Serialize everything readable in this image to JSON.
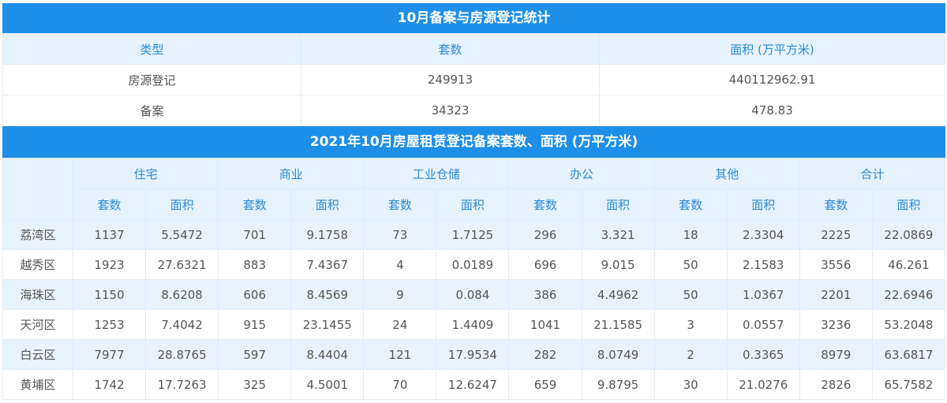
{
  "table1": {
    "title": "10月备案与房源登记统计",
    "headers": [
      "类型",
      "套数",
      "面积 (万平方米)"
    ],
    "rows": [
      [
        "房源登记",
        "249913",
        "440112962.91"
      ],
      [
        "备案",
        "34323",
        "478.83"
      ]
    ]
  },
  "table2": {
    "title": "2021年10月房屋租赁登记备案套数、面积 (万平方米)",
    "groups": [
      "住宅",
      "商业",
      "工业仓储",
      "办公",
      "其他",
      "合计"
    ],
    "sub": [
      "套数",
      "面积"
    ],
    "rows": [
      [
        "荔湾区",
        "1137",
        "5.5472",
        "701",
        "9.1758",
        "73",
        "1.7125",
        "296",
        "3.321",
        "18",
        "2.3304",
        "2225",
        "22.0869"
      ],
      [
        "越秀区",
        "1923",
        "27.6321",
        "883",
        "7.4367",
        "4",
        "0.0189",
        "696",
        "9.015",
        "50",
        "2.1583",
        "3556",
        "46.261"
      ],
      [
        "海珠区",
        "1150",
        "8.6208",
        "606",
        "8.4569",
        "9",
        "0.084",
        "386",
        "4.4962",
        "50",
        "1.0367",
        "2201",
        "22.6946"
      ],
      [
        "天河区",
        "1253",
        "7.4042",
        "915",
        "23.1455",
        "24",
        "1.4409",
        "1041",
        "21.1585",
        "3",
        "0.0557",
        "3236",
        "53.2048"
      ],
      [
        "白云区",
        "7977",
        "28.8765",
        "597",
        "8.4404",
        "121",
        "17.9534",
        "282",
        "8.0749",
        "2",
        "0.3365",
        "8979",
        "63.6817"
      ],
      [
        "黄埔区",
        "1742",
        "17.7263",
        "325",
        "4.5001",
        "70",
        "12.6247",
        "659",
        "9.8795",
        "30",
        "21.0276",
        "2826",
        "65.7582"
      ]
    ]
  }
}
